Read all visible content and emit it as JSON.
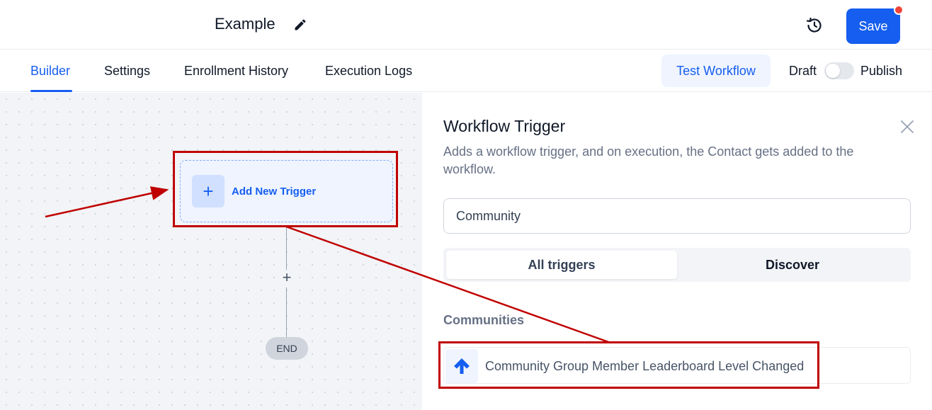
{
  "header": {
    "workflow_title": "Example",
    "save_label": "Save"
  },
  "tabs": [
    {
      "label": "Builder",
      "active": true
    },
    {
      "label": "Settings",
      "active": false
    },
    {
      "label": "Enrollment History",
      "active": false
    },
    {
      "label": "Execution Logs",
      "active": false
    }
  ],
  "toolbar": {
    "test_workflow_label": "Test Workflow",
    "draft_label": "Draft",
    "publish_label": "Publish",
    "published": false
  },
  "canvas": {
    "add_trigger_label": "Add New Trigger",
    "add_step_symbol": "+",
    "end_label": "END"
  },
  "panel": {
    "title": "Workflow Trigger",
    "description": "Adds a workflow trigger, and on execution, the Contact gets added to the workflow.",
    "search_value": "Community",
    "segments": [
      {
        "label": "All triggers",
        "active": true
      },
      {
        "label": "Discover",
        "active": false
      }
    ],
    "section_heading": "Communities",
    "trigger_items": [
      {
        "label": "Community Group Member Leaderboard Level Changed",
        "icon": "arrow-up-icon"
      }
    ]
  },
  "colors": {
    "accent": "#155eef",
    "notification_dot": "#f04438",
    "annotation": "#c00000"
  }
}
